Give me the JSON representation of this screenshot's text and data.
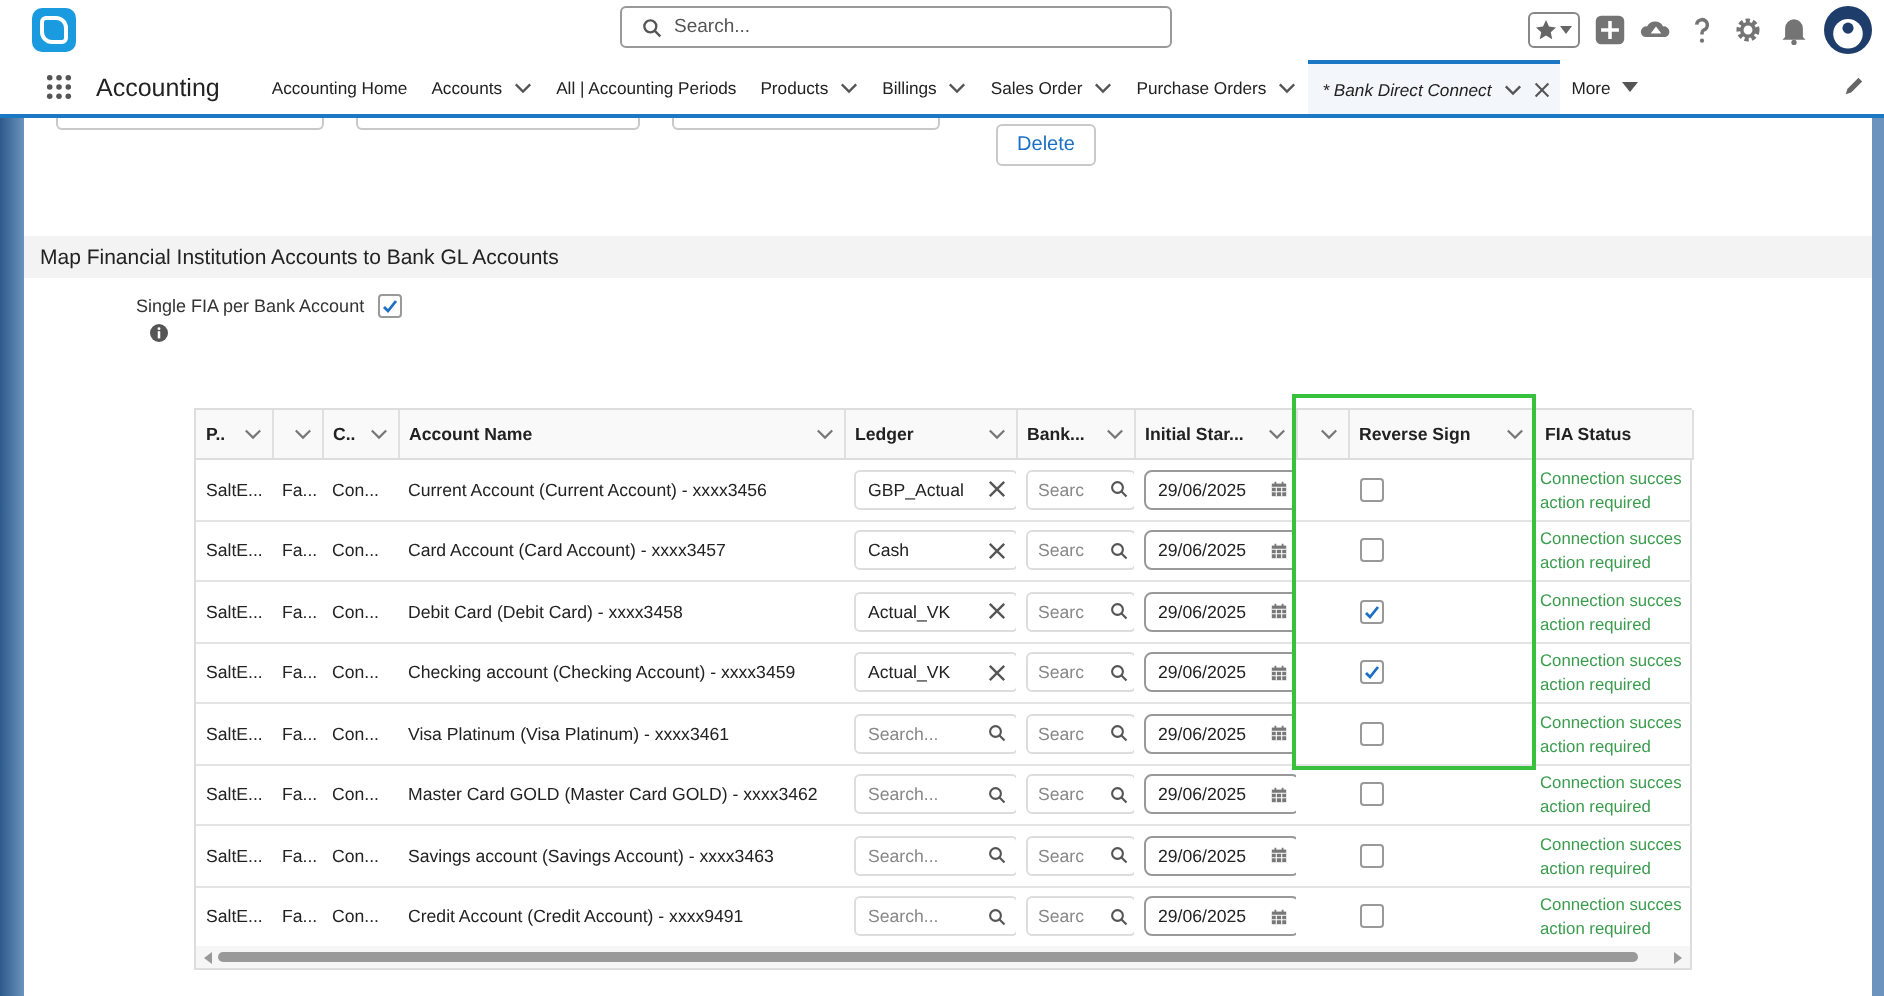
{
  "header": {
    "search": {
      "placeholder": "Search..."
    }
  },
  "nav": {
    "app_name": "Accounting",
    "tabs": [
      {
        "label": "Accounting Home",
        "dropdown": false,
        "selected": false
      },
      {
        "label": "Accounts",
        "dropdown": true,
        "selected": false
      },
      {
        "label": "All | Accounting Periods",
        "dropdown": false,
        "selected": false
      },
      {
        "label": "Products",
        "dropdown": true,
        "selected": false
      },
      {
        "label": "Billings",
        "dropdown": true,
        "selected": false
      },
      {
        "label": "Sales Order",
        "dropdown": true,
        "selected": false
      },
      {
        "label": "Purchase Orders",
        "dropdown": true,
        "selected": false
      },
      {
        "label": "* Bank Direct Connect",
        "dropdown": true,
        "selected": true
      }
    ],
    "more": "More"
  },
  "delete_button": "Delete",
  "section": {
    "title": "Map Financial Institution Accounts to Bank GL Accounts",
    "single_fia": {
      "label": "Single FIA per Bank Account",
      "checked": true
    }
  },
  "table": {
    "columns": [
      {
        "label": "P..",
        "menu": true
      },
      {
        "menu": true
      },
      {
        "label": "C..",
        "menu": true
      },
      {
        "label": "Account Name",
        "menu": true
      },
      {
        "label": "Ledger",
        "menu": true
      },
      {
        "label": "Bank...",
        "menu": true
      },
      {
        "label": "Initial Star...",
        "menu": true
      },
      {
        "menu": true
      },
      {
        "label": "Reverse Sign",
        "menu": true
      },
      {
        "label": "FIA Status",
        "menu": false
      }
    ],
    "rows": [
      {
        "column_1": "SaltE...",
        "column_2": "Fa...",
        "column_3": "Con...",
        "account_name": "Current Account (Current Account) - xxxx3456",
        "ledger": {
          "value": "GBP_Actual"
        },
        "bank": {
          "placeholder": "Searc"
        },
        "initial_start": "29/06/2025",
        "reverse_sign": false,
        "fia_status": "Connection succes\naction required"
      },
      {
        "column_1": "SaltE...",
        "column_2": "Fa...",
        "column_3": "Con...",
        "account_name": "Card Account (Card Account) - xxxx3457",
        "ledger": {
          "value": "Cash"
        },
        "bank": {
          "placeholder": "Searc"
        },
        "initial_start": "29/06/2025",
        "reverse_sign": false,
        "fia_status": "Connection succes\naction required"
      },
      {
        "column_1": "SaltE...",
        "column_2": "Fa...",
        "column_3": "Con...",
        "account_name": "Debit Card (Debit Card) - xxxx3458",
        "ledger": {
          "value": "Actual_VK"
        },
        "bank": {
          "placeholder": "Searc"
        },
        "initial_start": "29/06/2025",
        "reverse_sign": true,
        "fia_status": "Connection succes\naction required"
      },
      {
        "column_1": "SaltE...",
        "column_2": "Fa...",
        "column_3": "Con...",
        "account_name": "Checking account (Checking Account) - xxxx3459",
        "ledger": {
          "value": "Actual_VK"
        },
        "bank": {
          "placeholder": "Searc"
        },
        "initial_start": "29/06/2025",
        "reverse_sign": true,
        "fia_status": "Connection succes\naction required"
      },
      {
        "column_1": "SaltE...",
        "column_2": "Fa...",
        "column_3": "Con...",
        "account_name": "Visa Platinum (Visa Platinum) - xxxx3461",
        "ledger": {
          "placeholder": "Search..."
        },
        "bank": {
          "placeholder": "Searc"
        },
        "initial_start": "29/06/2025",
        "reverse_sign": false,
        "fia_status": "Connection succes\naction required"
      },
      {
        "column_1": "SaltE...",
        "column_2": "Fa...",
        "column_3": "Con...",
        "account_name": "Master Card GOLD (Master Card GOLD) - xxxx3462",
        "ledger": {
          "placeholder": "Search..."
        },
        "bank": {
          "placeholder": "Searc"
        },
        "initial_start": "29/06/2025",
        "reverse_sign": false,
        "fia_status": "Connection succes\naction required"
      },
      {
        "column_1": "SaltE...",
        "column_2": "Fa...",
        "column_3": "Con...",
        "account_name": "Savings account (Savings Account) - xxxx3463",
        "ledger": {
          "placeholder": "Search..."
        },
        "bank": {
          "placeholder": "Searc"
        },
        "initial_start": "29/06/2025",
        "reverse_sign": false,
        "fia_status": "Connection succes\naction required"
      },
      {
        "column_1": "SaltE...",
        "column_2": "Fa...",
        "column_3": "Con...",
        "account_name": "Credit Account (Credit Account) - xxxx9491",
        "ledger": {
          "placeholder": "Search..."
        },
        "bank": {
          "placeholder": "Searc"
        },
        "initial_start": "29/06/2025",
        "reverse_sign": false,
        "fia_status": "Connection succes\naction required"
      }
    ]
  }
}
